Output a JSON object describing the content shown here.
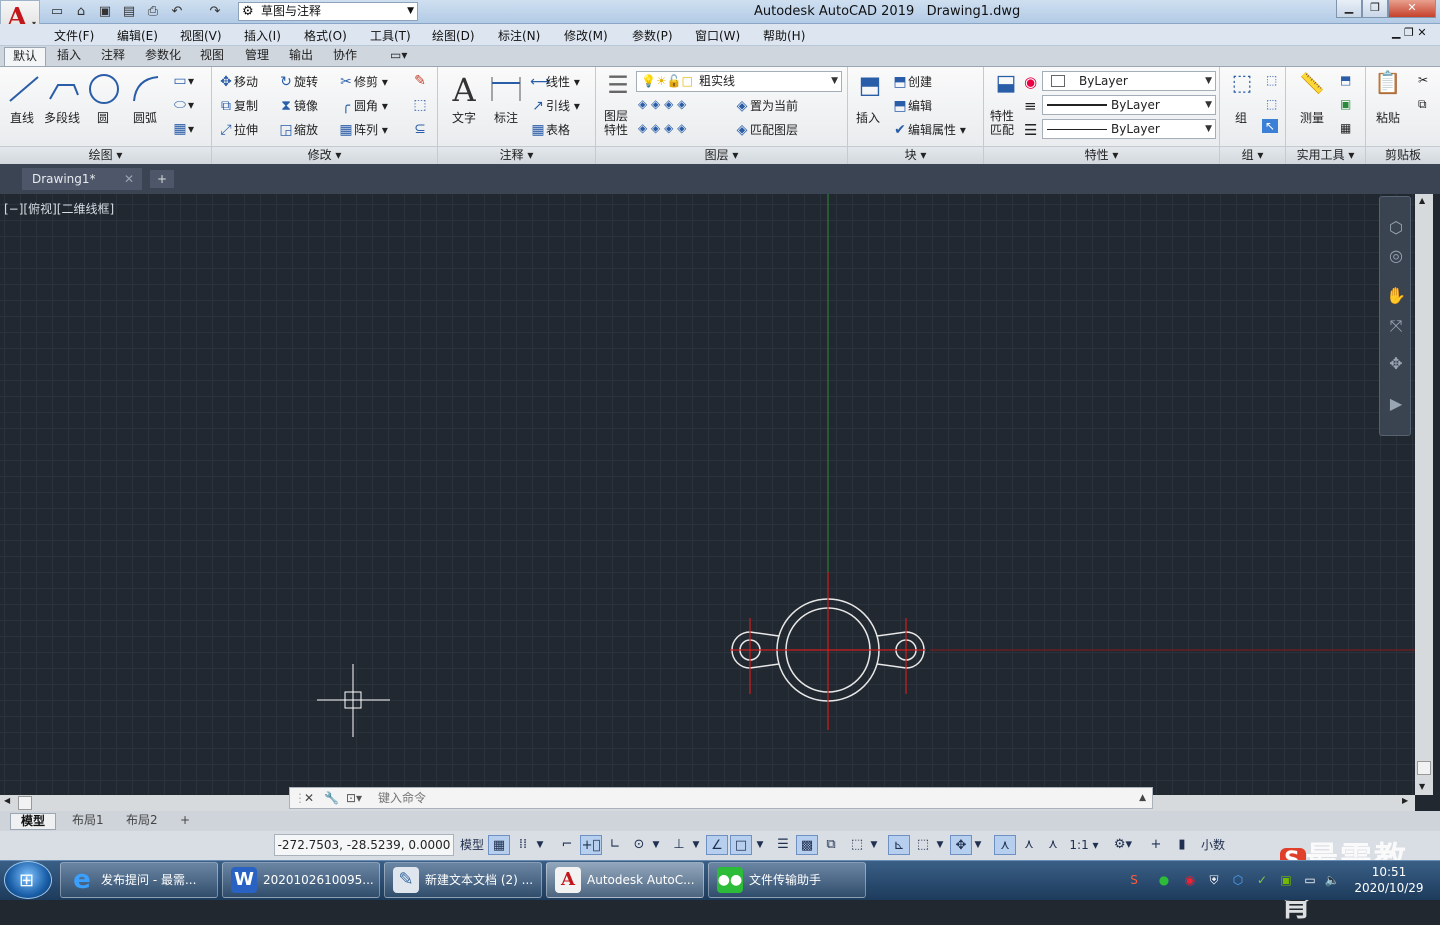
{
  "window": {
    "app_title": "Autodesk AutoCAD 2019",
    "doc_title": "Drawing1.dwg",
    "workspace": "草图与注释"
  },
  "menu": [
    "文件(F)",
    "编辑(E)",
    "视图(V)",
    "插入(I)",
    "格式(O)",
    "工具(T)",
    "绘图(D)",
    "标注(N)",
    "修改(M)",
    "参数(P)",
    "窗口(W)",
    "帮助(H)"
  ],
  "ribbon_tabs": [
    "默认",
    "插入",
    "注释",
    "参数化",
    "视图",
    "管理",
    "输出",
    "协作"
  ],
  "ribbon": {
    "draw": {
      "title": "绘图",
      "line": "直线",
      "polyline": "多段线",
      "circle": "圆",
      "arc": "圆弧"
    },
    "modify": {
      "title": "修改",
      "move": "移动",
      "rotate": "旋转",
      "trim": "修剪",
      "copy": "复制",
      "mirror": "镜像",
      "fillet": "圆角",
      "stretch": "拉伸",
      "scale": "缩放",
      "array": "阵列"
    },
    "annotation": {
      "title": "注释",
      "text": "文字",
      "dimension": "标注",
      "linear": "线性",
      "leader": "引线",
      "table": "表格"
    },
    "layers": {
      "title": "图层",
      "layer_props": "图层特性",
      "current_layer": "粗实线",
      "set_current": "置为当前",
      "match_layer": "匹配图层"
    },
    "block": {
      "title": "块",
      "insert": "插入",
      "create": "创建",
      "edit": "编辑",
      "edit_attr": "编辑属性"
    },
    "properties": {
      "title": "特性",
      "match": "特性匹配",
      "color": "ByLayer",
      "linetype": "ByLayer",
      "lineweight": "ByLayer"
    },
    "groups": {
      "title": "组",
      "group": "组"
    },
    "utilities": {
      "title": "实用工具",
      "measure": "测量"
    },
    "clipboard": {
      "title": "剪贴板",
      "paste": "粘贴"
    }
  },
  "doc_tab": "Drawing1*",
  "viewport_label": "[−][俯视][二维线框]",
  "command_placeholder": "键入命令",
  "layout_tabs": [
    "模型",
    "布局1",
    "布局2"
  ],
  "status": {
    "coords": "-272.7503, -28.5239, 0.0000",
    "model": "模型",
    "scale": "1:1",
    "units": "小数"
  },
  "taskbar": {
    "items": [
      "发布提问 - 最需...",
      "2020102610095...",
      "新建文本文档 (2) ...",
      "Autodesk AutoC...",
      "文件传输助手"
    ],
    "time": "10:51",
    "date": "2020/10/29"
  },
  "watermark": "最需教育",
  "colors": {
    "axis_x": "#c0161b",
    "axis_y": "#2f8a3a",
    "geometry": "#e8e8e8",
    "center": "#d01d1d",
    "canvas": "#212830"
  }
}
